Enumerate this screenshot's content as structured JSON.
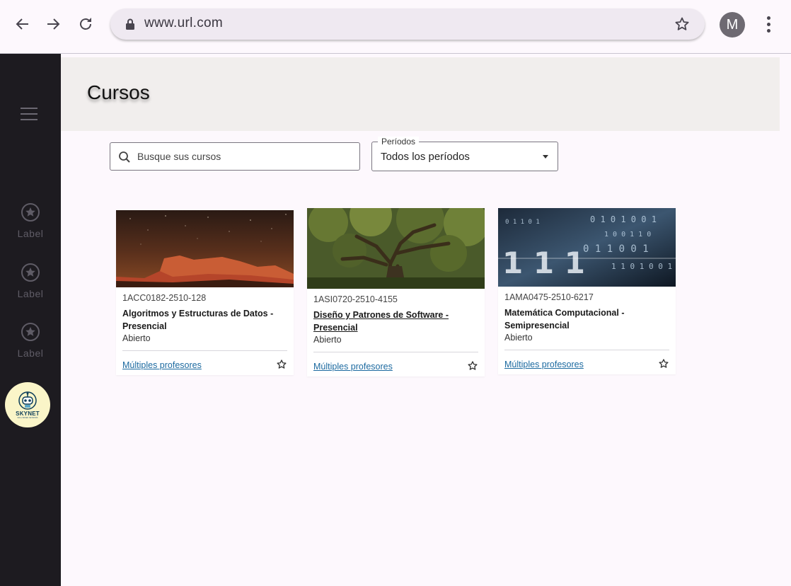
{
  "browser": {
    "url": "www.url.com",
    "avatar_letter": "M"
  },
  "sidebar": {
    "items": [
      {
        "label": "Label",
        "icon": "star-circle-icon"
      },
      {
        "label": "Label",
        "icon": "star-circle-icon"
      },
      {
        "label": "Label",
        "icon": "star-circle-icon"
      }
    ],
    "logo": {
      "text": "SKYNET",
      "sub": "SKILL BASED NETWORK"
    }
  },
  "page": {
    "title": "Cursos"
  },
  "filters": {
    "search_placeholder": "Busque sus cursos",
    "period_label": "Períodos",
    "period_value": "Todos los períodos"
  },
  "courses": [
    {
      "code": "1ACC0182-2510-128",
      "title": "Algoritmos y Estructuras de Datos - Presencial",
      "status": "Abierto",
      "teachers": "Múltiples profesores",
      "image": "desert-night-rock"
    },
    {
      "code": "1ASI0720-2510-4155",
      "title": "Diseño y Patrones de Software - Presencial",
      "status": "Abierto",
      "teachers": "Múltiples profesores",
      "image": "green-tree-forest"
    },
    {
      "code": "1AMA0475-2510-6217",
      "title": "Matemática Computacional - Semipresencial",
      "status": "Abierto",
      "teachers": "Múltiples profesores",
      "image": "binary-code"
    }
  ],
  "colors": {
    "sidebar": "#1d1b20",
    "header_band": "#f1eeed",
    "link": "#1c6aa0",
    "page_bg": "#fdf8fd"
  }
}
